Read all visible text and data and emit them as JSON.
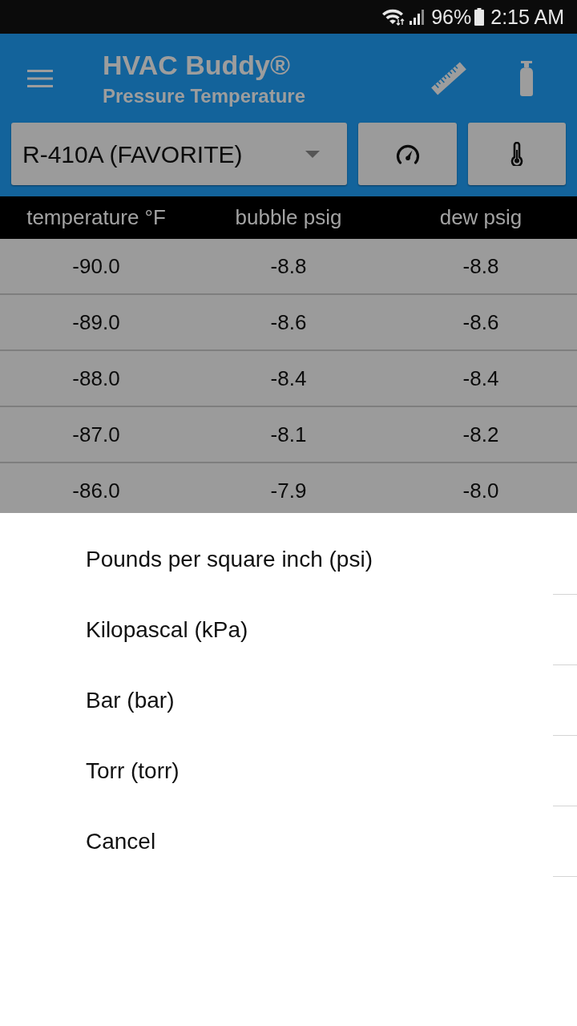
{
  "status_bar": {
    "battery": "96%",
    "time": "2:15 AM"
  },
  "app_bar": {
    "title": "HVAC Buddy®",
    "subtitle": "Pressure Temperature"
  },
  "refrigerant_select": {
    "value": "R-410A (FAVORITE)"
  },
  "table": {
    "columns": [
      "temperature °F",
      "bubble psig",
      "dew psig"
    ],
    "rows": [
      [
        "-90.0",
        "-8.8",
        "-8.8"
      ],
      [
        "-89.0",
        "-8.6",
        "-8.6"
      ],
      [
        "-88.0",
        "-8.4",
        "-8.4"
      ],
      [
        "-87.0",
        "-8.1",
        "-8.2"
      ],
      [
        "-86.0",
        "-7.9",
        "-8.0"
      ]
    ]
  },
  "unit_sheet": {
    "options": [
      "Pounds per square inch (psi)",
      "Kilopascal (kPa)",
      "Bar (bar)",
      "Torr (torr)"
    ],
    "cancel": "Cancel"
  }
}
